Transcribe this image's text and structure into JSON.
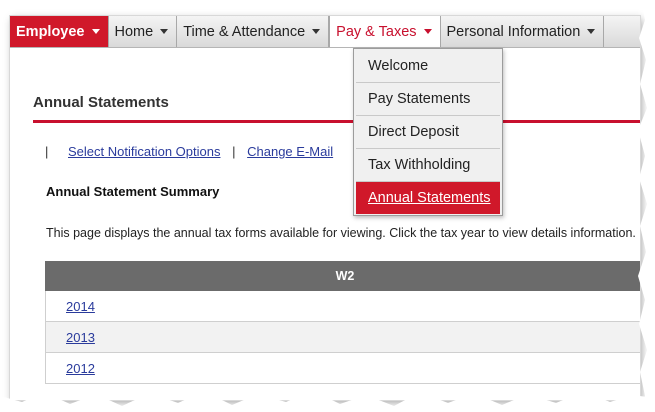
{
  "nav": {
    "employee": "Employee",
    "home": "Home",
    "time": "Time & Attendance",
    "pay": "Pay & Taxes",
    "personal": "Personal Information"
  },
  "dropdown": {
    "items": [
      "Welcome",
      "Pay Statements",
      "Direct Deposit",
      "Tax Withholding",
      "Annual Statements"
    ],
    "selected": "Annual Statements"
  },
  "page": {
    "title": "Annual Statements",
    "sep": "|",
    "link1": "Select Notification Options",
    "link2": "Change E-Mail",
    "section": "Annual Statement Summary",
    "description": "This page displays the annual tax forms available for viewing. Click the tax year to view details information."
  },
  "table": {
    "header": "W2",
    "rows": [
      "2014",
      "2013",
      "2012"
    ]
  },
  "colors": {
    "brand_red": "#d0182a",
    "link_blue": "#2a3b9c",
    "header_gray": "#6b6b6b"
  }
}
